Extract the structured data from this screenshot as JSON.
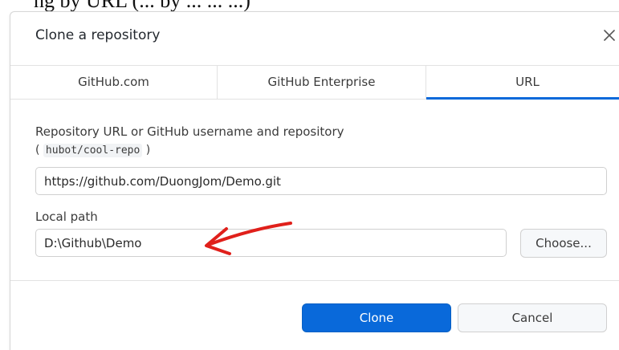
{
  "overlay_text": "ng by URL (... by ... ... ...)",
  "dialog": {
    "title": "Clone a repository",
    "close_icon": "close-icon"
  },
  "tabs": [
    {
      "label": "GitHub.com",
      "active": false
    },
    {
      "label": "GitHub Enterprise",
      "active": false
    },
    {
      "label": "URL",
      "active": true
    }
  ],
  "repo_url": {
    "label": "Repository URL or GitHub username and repository",
    "hint_open": "(",
    "hint_code": "hubot/cool-repo",
    "hint_close": ")",
    "value": "https://github.com/DuongJom/Demo.git"
  },
  "local_path": {
    "label": "Local path",
    "value": "D:\\Github\\Demo",
    "choose_label": "Choose..."
  },
  "footer": {
    "clone_label": "Clone",
    "cancel_label": "Cancel"
  },
  "colors": {
    "accent": "#0969da",
    "annotation_arrow": "#e0201b"
  }
}
